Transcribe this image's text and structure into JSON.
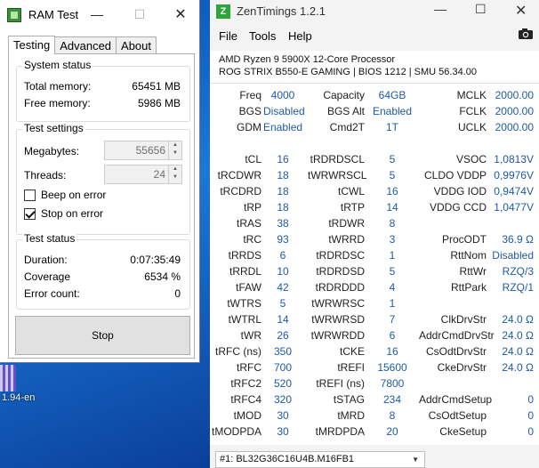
{
  "desktop": {
    "label": "1.94-en"
  },
  "ramtest": {
    "title": "RAM Test",
    "tabs": [
      "Testing",
      "Advanced",
      "About"
    ],
    "system_status": {
      "title": "System status",
      "total_label": "Total memory:",
      "total_value": "65451 MB",
      "free_label": "Free memory:",
      "free_value": "5986 MB"
    },
    "test_settings": {
      "title": "Test settings",
      "megabytes_label": "Megabytes:",
      "megabytes_value": "55656",
      "threads_label": "Threads:",
      "threads_value": "24",
      "beep_label": "Beep on error",
      "beep_checked": false,
      "stop_label": "Stop on error",
      "stop_checked": true
    },
    "test_status": {
      "title": "Test status",
      "duration_label": "Duration:",
      "duration_value": "0:07:35:49",
      "coverage_label": "Coverage",
      "coverage_value": "6534 %",
      "errors_label": "Error count:",
      "errors_value": "0"
    },
    "stop_button": "Stop"
  },
  "zen": {
    "icon_letter": "Z",
    "title": "ZenTimings 1.2.1",
    "menu": [
      "File",
      "Tools",
      "Help"
    ],
    "cpu": "AMD Ryzen 9 5900X 12-Core Processor",
    "board": "ROG STRIX B550-E GAMING | BIOS 1212 | SMU 56.34.00",
    "top": [
      [
        "Freq",
        "4000",
        "Capacity",
        "64GB",
        "MCLK",
        "2000.00"
      ],
      [
        "BGS",
        "Disabled",
        "BGS Alt",
        "Enabled",
        "FCLK",
        "2000.00"
      ],
      [
        "GDM",
        "Enabled",
        "Cmd2T",
        "1T",
        "UCLK",
        "2000.00"
      ]
    ],
    "timings": [
      [
        "tCL",
        "16",
        "tRDRDSCL",
        "5",
        "VSOC",
        "1,0813V"
      ],
      [
        "tRCDWR",
        "18",
        "tWRWRSCL",
        "5",
        "CLDO VDDP",
        "0,9976V"
      ],
      [
        "tRCDRD",
        "18",
        "tCWL",
        "16",
        "VDDG IOD",
        "0,9474V"
      ],
      [
        "tRP",
        "18",
        "tRTP",
        "14",
        "VDDG CCD",
        "1,0477V"
      ],
      [
        "tRAS",
        "38",
        "tRDWR",
        "8",
        "",
        ""
      ],
      [
        "tRC",
        "93",
        "tWRRD",
        "3",
        "ProcODT",
        "36.9 Ω"
      ],
      [
        "tRRDS",
        "6",
        "tRDRDSC",
        "1",
        "RttNom",
        "Disabled"
      ],
      [
        "tRRDL",
        "10",
        "tRDRDSD",
        "5",
        "RttWr",
        "RZQ/3"
      ],
      [
        "tFAW",
        "42",
        "tRDRDDD",
        "4",
        "RttPark",
        "RZQ/1"
      ],
      [
        "tWTRS",
        "5",
        "tWRWRSC",
        "1",
        "",
        ""
      ],
      [
        "tWTRL",
        "14",
        "tWRWRSD",
        "7",
        "ClkDrvStr",
        "24.0 Ω"
      ],
      [
        "tWR",
        "26",
        "tWRWRDD",
        "6",
        "AddrCmdDrvStr",
        "24.0 Ω"
      ],
      [
        "tRFC (ns)",
        "350",
        "tCKE",
        "16",
        "CsOdtDrvStr",
        "24.0 Ω"
      ],
      [
        "tRFC",
        "700",
        "tREFI",
        "15600",
        "CkeDrvStr",
        "24.0 Ω"
      ],
      [
        "tRFC2",
        "520",
        "tREFI (ns)",
        "7800",
        "",
        ""
      ],
      [
        "tRFC4",
        "320",
        "tSTAG",
        "234",
        "AddrCmdSetup",
        "0"
      ],
      [
        "tMOD",
        "30",
        "tMRD",
        "8",
        "CsOdtSetup",
        "0"
      ],
      [
        "tMODPDA",
        "30",
        "tMRDPDA",
        "20",
        "CkeSetup",
        "0"
      ]
    ],
    "module": "#1: BL32G36C16U4B.M16FB1"
  }
}
